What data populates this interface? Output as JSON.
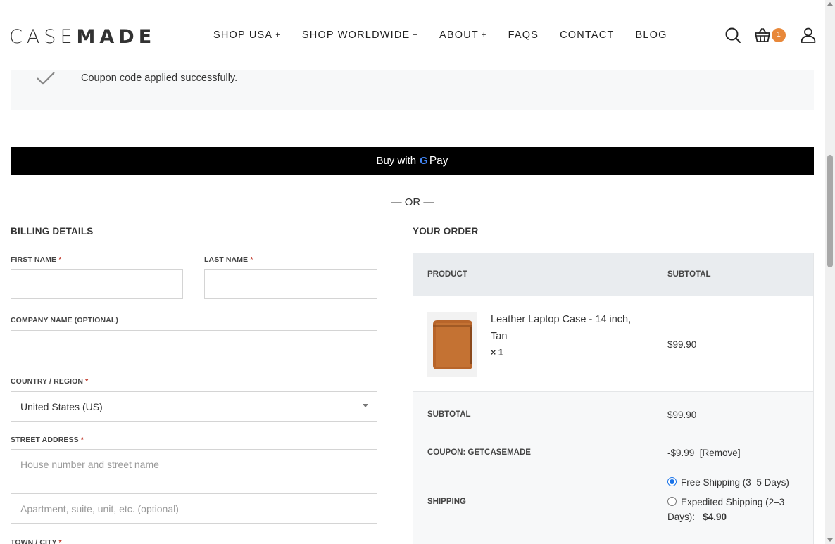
{
  "header": {
    "logo_light": "CASE",
    "logo_bold": "MADE",
    "nav": [
      {
        "label": "SHOP USA",
        "plus": "+"
      },
      {
        "label": "SHOP WORLDWIDE",
        "plus": "+"
      },
      {
        "label": "ABOUT",
        "plus": "+"
      },
      {
        "label": "FAQS",
        "plus": ""
      },
      {
        "label": "CONTACT",
        "plus": ""
      },
      {
        "label": "BLOG",
        "plus": ""
      }
    ],
    "cart_count": "1"
  },
  "notice": {
    "text": "Coupon code applied successfully."
  },
  "gpay": {
    "buy_with": "Buy with",
    "g": "G",
    "pay": "Pay"
  },
  "or_text": "— OR —",
  "billing": {
    "title": "BILLING DETAILS",
    "first_name_label": "FIRST NAME",
    "last_name_label": "LAST NAME",
    "company_label": "COMPANY NAME (OPTIONAL)",
    "country_label": "COUNTRY / REGION",
    "country_value": "United States (US)",
    "street_label": "STREET ADDRESS",
    "street_placeholder": "House number and street name",
    "apt_placeholder": "Apartment, suite, unit, etc. (optional)",
    "town_label": "TOWN / CITY",
    "required_mark": "*"
  },
  "order": {
    "title": "YOUR ORDER",
    "col_product": "PRODUCT",
    "col_subtotal": "SUBTOTAL",
    "item": {
      "name_line1": "Leather Laptop Case - 14 inch,",
      "name_line2": "Tan",
      "qty": "× 1",
      "price": "$99.90"
    },
    "subtotal_label": "SUBTOTAL",
    "subtotal_value": "$99.90",
    "coupon_label": "COUPON: GETCASEMADE",
    "coupon_value": "-$9.99",
    "coupon_remove": "[Remove]",
    "shipping_label": "SHIPPING",
    "shipping_free": "Free Shipping (3–5 Days)",
    "shipping_expedited_line1": "Expedited Shipping (2–3",
    "shipping_expedited_line2": "Days):",
    "shipping_expedited_price": "$4.90"
  },
  "colors": {
    "accent": "#e8883a",
    "radio": "#1a73e8",
    "required": "#c0392b"
  }
}
